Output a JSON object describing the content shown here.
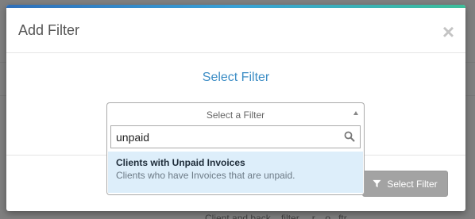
{
  "modal": {
    "title": "Add Filter",
    "close_label": "×",
    "section_title": "Select Filter"
  },
  "select": {
    "placeholder": "Select a Filter"
  },
  "search": {
    "value": "unpaid"
  },
  "results": [
    {
      "title": "Clients with Unpaid Invoices",
      "description": "Clients who have Invoices that are unpaid."
    }
  ],
  "footer": {
    "select_filter_label": "Select Filter"
  },
  "background": {
    "partial_text": "Client and back... filter.... r... o...ftr..."
  },
  "colors": {
    "accent": "#3c8dc5",
    "highlight": "#ddeefa",
    "disabled_button": "#a3a3a3"
  },
  "icons": {
    "close": "close-icon",
    "search": "search-icon",
    "filter": "filter-icon",
    "dropdown_arrow": "caret-up-icon"
  }
}
